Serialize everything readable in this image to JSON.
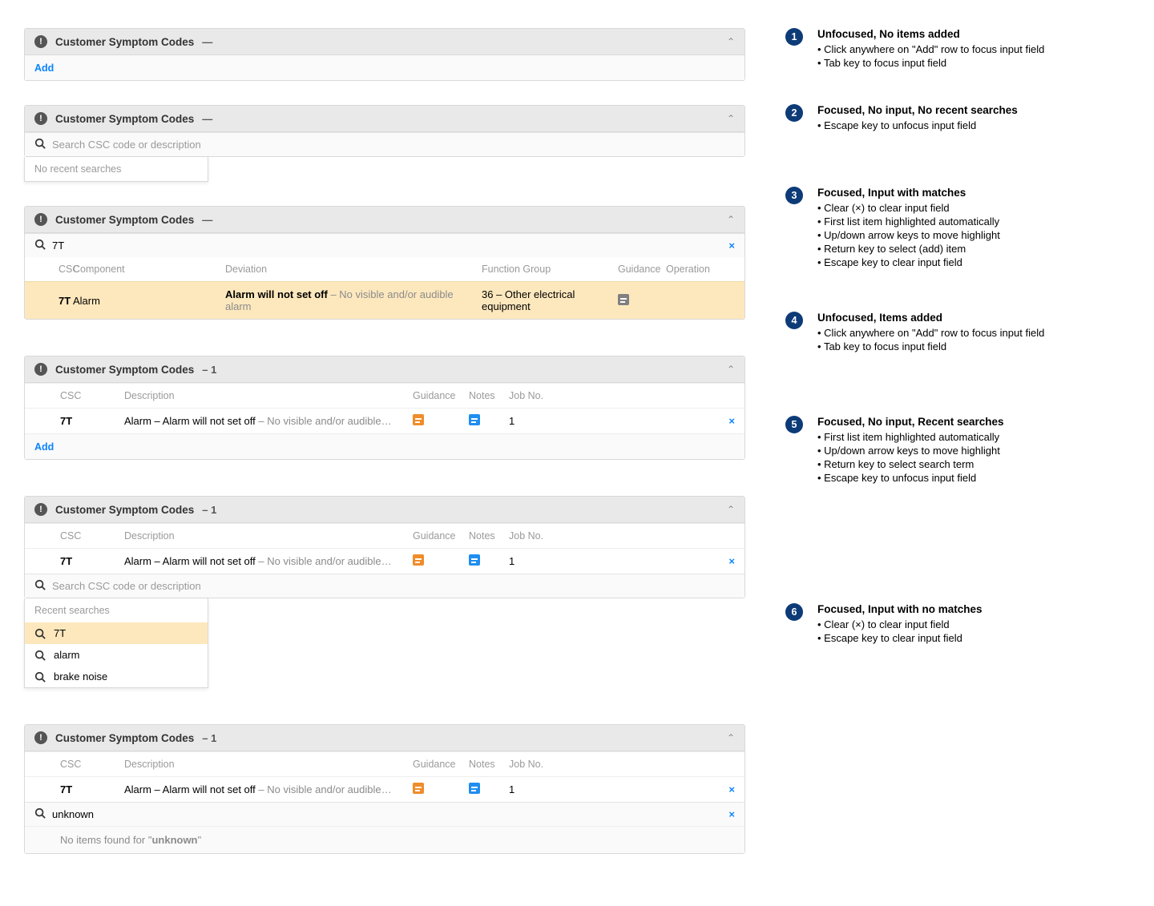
{
  "common": {
    "panel_title": "Customer Symptom Codes",
    "dash": "—",
    "suffix_count": "– 1",
    "add_label": "Add",
    "search_placeholder": "Search CSC code or description",
    "no_recent": "No recent searches",
    "recent_label": "Recent searches",
    "clear_x": "×",
    "chevron": "⌃"
  },
  "state3": {
    "input_value": "7T",
    "headers": {
      "csc": "CSC",
      "component": "Component",
      "deviation": "Deviation",
      "function_group": "Function Group",
      "guidance": "Guidance",
      "operation": "Operation"
    },
    "row": {
      "csc": "7T",
      "component": "Alarm",
      "deviation_bold": "Alarm will not set off",
      "deviation_gray": " – No visible and/or audible alarm",
      "function_group": "36 – Other electrical equipment"
    }
  },
  "items_headers": {
    "csc": "CSC",
    "desc": "Description",
    "guidance": "Guidance",
    "notes": "Notes",
    "job": "Job No."
  },
  "item_row": {
    "csc": "7T",
    "desc_bold": "Alarm – Alarm will not set off",
    "desc_gray": " – No visible and/or audible…",
    "job": "1",
    "delete": "×"
  },
  "state5": {
    "recents": [
      "7T",
      "alarm",
      "brake noise"
    ]
  },
  "state6": {
    "input_value": "unknown",
    "no_items_prefix": "No items found for \"",
    "no_items_term": "unknown",
    "no_items_suffix": "\""
  },
  "annotations": [
    {
      "n": "1",
      "title": "Unfocused, No items added",
      "bullets": [
        "Click anywhere on \"Add\" row to focus input field",
        "Tab key to focus input field"
      ]
    },
    {
      "n": "2",
      "title": "Focused, No input, No recent searches",
      "bullets": [
        "Escape key to unfocus input field"
      ]
    },
    {
      "n": "3",
      "title": "Focused, Input with matches",
      "bullets": [
        "Clear (×) to clear input field",
        "First list item highlighted automatically",
        "Up/down arrow keys to move highlight",
        "Return key to select (add) item",
        "Escape key to clear input field"
      ]
    },
    {
      "n": "4",
      "title": "Unfocused, Items added",
      "bullets": [
        "Click anywhere on \"Add\" row to focus input field",
        "Tab key to focus input field"
      ]
    },
    {
      "n": "5",
      "title": "Focused, No input, Recent searches",
      "bullets": [
        "First list item highlighted automatically",
        "Up/down arrow keys to move highlight",
        "Return key to select search term",
        "Escape key to unfocus input field"
      ]
    },
    {
      "n": "6",
      "title": "Focused, Input with no matches",
      "bullets": [
        "Clear (×) to clear input field",
        "Escape key to clear input field"
      ]
    }
  ]
}
